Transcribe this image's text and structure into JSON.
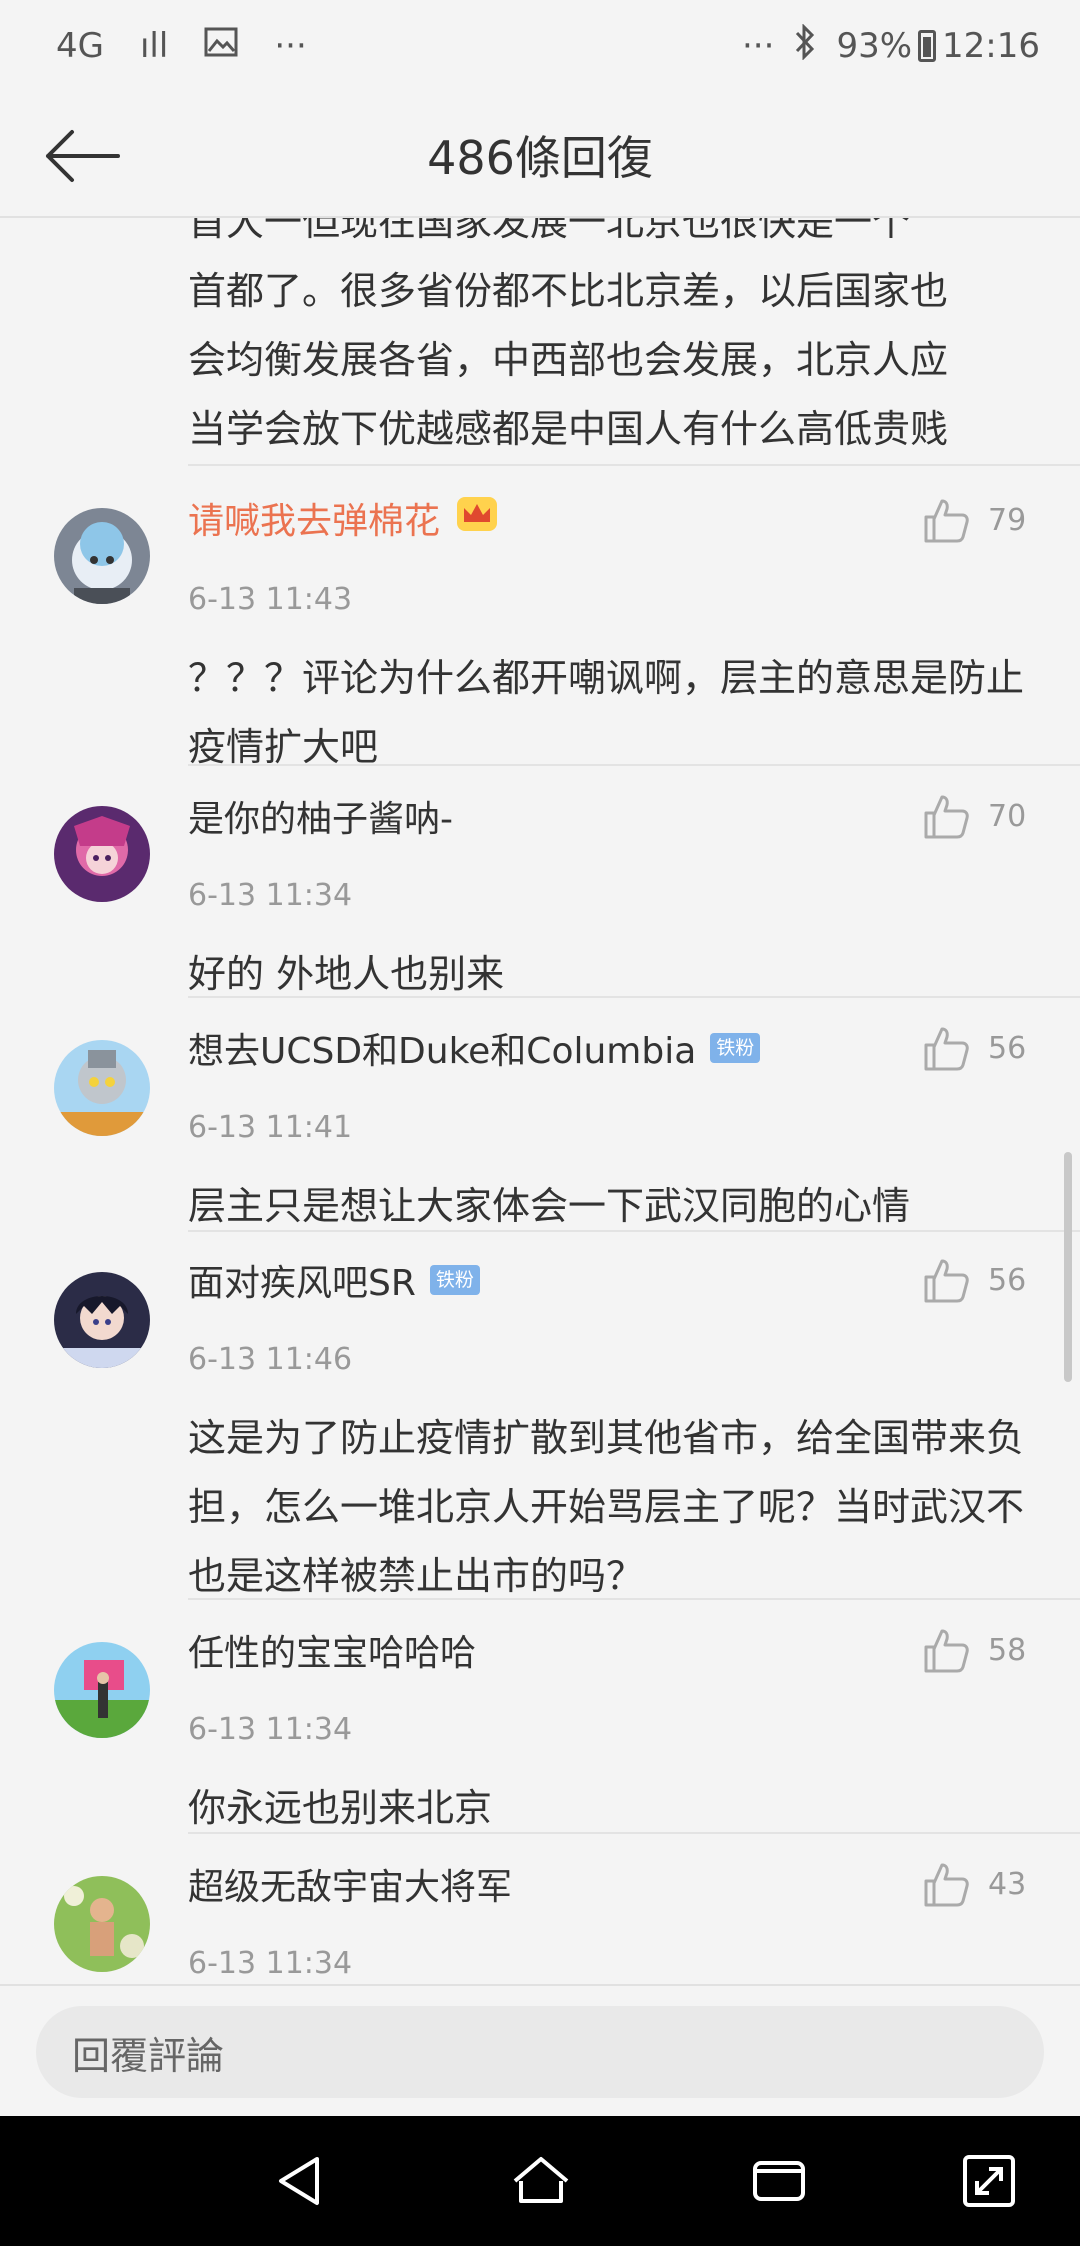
{
  "status_bar": {
    "network": "4G",
    "signal": "ıll",
    "gallery_icon": "image-icon",
    "dots_left": "···",
    "dots_right": "···",
    "bluetooth": "bluetooth-icon",
    "battery": "93%",
    "time": "12:16"
  },
  "header": {
    "title": "486條回復",
    "back_icon": "arrow-left-icon"
  },
  "partial_comment": {
    "lines": [
      "首大一但现在国家发展一北京也很快是一个",
      "首都了。很多省份都不比北京差，以后国家也",
      "会均衡发展各省，中西部也会发展，北京人应",
      "当学会放下优越感都是中国人有什么高低贵贱"
    ]
  },
  "comments": [
    {
      "user": "请喊我去弹棉花",
      "time": "6-13 11:43",
      "likes": "79",
      "text": "？？？评论为什么都开嘲讽啊，层主的意思是防止疫情扩大吧",
      "badge": ""
    },
    {
      "user": "是你的柚子酱呐-",
      "time": "6-13 11:34",
      "likes": "70",
      "text": "好的 外地人也别来",
      "badge": ""
    },
    {
      "user": "想去UCSD和Duke和Columbia",
      "time": "6-13 11:41",
      "likes": "56",
      "text": "层主只是想让大家体会一下武汉同胞的心情",
      "badge": "铁粉"
    },
    {
      "user": "面对疾风吧SR",
      "time": "6-13 11:46",
      "likes": "56",
      "text": "这是为了防止疫情扩散到其他省市，给全国带来负担，怎么一堆北京人开始骂层主了呢？当时武汉不也是这样被禁止出市的吗？",
      "badge": "铁粉"
    },
    {
      "user": "任性的宝宝哈哈哈",
      "time": "6-13 11:34",
      "likes": "58",
      "text": "你永远也别来北京",
      "badge": ""
    },
    {
      "user": "超级无敌宇宙大将军",
      "time": "6-13 11:34",
      "likes": "43",
      "text": "",
      "badge": ""
    }
  ],
  "reply_bar": {
    "placeholder": "回覆評論"
  },
  "colors": {
    "background": "#f4f4f4",
    "vip_name": "#eb7350",
    "badge": "#7fb2ea",
    "meta": "#999999"
  }
}
